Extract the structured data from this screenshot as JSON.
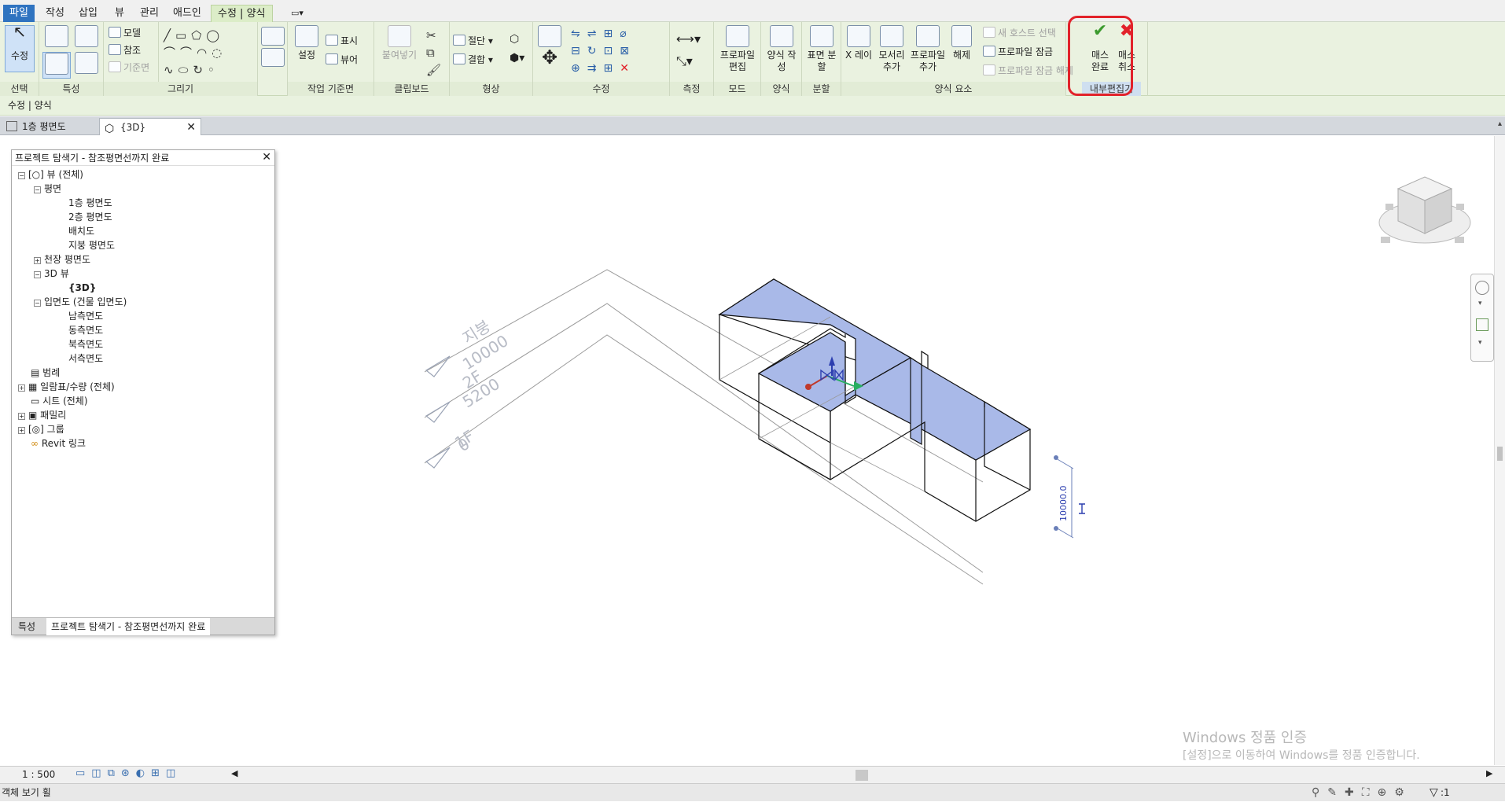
{
  "ribbon_tabs": [
    "파일",
    "작성",
    "삽입",
    "뷰",
    "관리",
    "애드인",
    "수정 | 양식"
  ],
  "ribbon": {
    "select": {
      "button": "수정",
      "title": "선택"
    },
    "properties": {
      "title": "특성"
    },
    "draw": {
      "model": "모델",
      "reference": "참조",
      "workplane": "기준면",
      "title": "그리기"
    },
    "workplane": {
      "set": "설정",
      "show": "표시",
      "viewer": "뷰어",
      "title": "작업 기준면"
    },
    "clipboard": {
      "paste": "붙여넣기",
      "title": "클립보드"
    },
    "geometry": {
      "cut": "절단",
      "join": "결합",
      "title": "형상"
    },
    "modify": {
      "title": "수정"
    },
    "measure": {
      "title": "측정"
    },
    "mode": {
      "edit_profile": "프로파일 편집",
      "title": "모드"
    },
    "form": {
      "create_form": "양식 작성",
      "title": "양식"
    },
    "divide": {
      "divide_surface": "표면 분할",
      "title": "분할"
    },
    "form_element": {
      "xray": "X 레이",
      "add_edge": "모서리 추가",
      "add_profile": "프로파일 추가",
      "dissolve": "해제",
      "pick_new_host": "새 호스트 선택",
      "lock_profiles": "프로파일 잠금",
      "unlock_profiles": "프로파일 잠금 해제",
      "title": "양식 요소"
    },
    "in_place": {
      "finish": "매스 완료",
      "cancel": "매스 취소",
      "title": "내부편집기"
    }
  },
  "context_bar": "수정 | 양식",
  "doc_tabs": [
    {
      "label": "1층 평면도"
    },
    {
      "label": "{3D}"
    }
  ],
  "project_browser": {
    "title": "프로젝트 탐색기 - 참조평면선까지 완료",
    "tree": [
      {
        "label": "뷰 (전체)",
        "level": 0
      },
      {
        "label": "평면",
        "level": 1
      },
      {
        "label": "1층 평면도",
        "level": 2
      },
      {
        "label": "2층 평면도",
        "level": 2
      },
      {
        "label": "배치도",
        "level": 2
      },
      {
        "label": "지붕 평면도",
        "level": 2
      },
      {
        "label": "천장 평면도",
        "level": 1
      },
      {
        "label": "3D 뷰",
        "level": 1
      },
      {
        "label": "{3D}",
        "level": 2
      },
      {
        "label": "입면도 (건물 입면도)",
        "level": 1
      },
      {
        "label": "남측면도",
        "level": 2
      },
      {
        "label": "동측면도",
        "level": 2
      },
      {
        "label": "북측면도",
        "level": 2
      },
      {
        "label": "서측면도",
        "level": 2
      },
      {
        "label": "범례",
        "level": 0
      },
      {
        "label": "일람표/수량 (전체)",
        "level": 0
      },
      {
        "label": "시트 (전체)",
        "level": 0
      },
      {
        "label": "패밀리",
        "level": 0
      },
      {
        "label": "그룹",
        "level": 0
      },
      {
        "label": "Revit 링크",
        "level": 0
      }
    ],
    "bottom_tabs": [
      "특성",
      "프로젝트 탐색기 - 참조평면선까지 완료"
    ]
  },
  "levels": [
    {
      "name": "지붕",
      "elev": "10000"
    },
    {
      "name": "2F",
      "elev": "5200"
    },
    {
      "name": "1F",
      "elev": "0"
    }
  ],
  "dimension": "10000.0",
  "scale": "1 : 500",
  "status_text": "객체 보기 휠",
  "filter_count": ":1",
  "watermark": {
    "line1": "Windows 정품 인증",
    "line2": "[설정]으로 이동하여 Windows를 정품 인증합니다."
  },
  "colors": {
    "accent": "#2f73c0",
    "mass_top": "#a9b9e8",
    "highlight": "#e2222a"
  }
}
